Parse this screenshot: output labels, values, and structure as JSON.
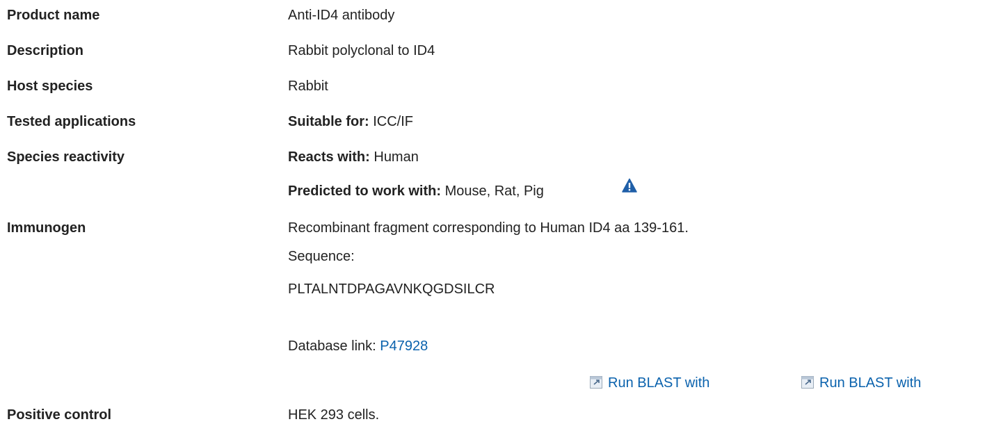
{
  "rows": {
    "product_name": {
      "label": "Product name",
      "value": "Anti-ID4 antibody"
    },
    "description": {
      "label": "Description",
      "value": "Rabbit polyclonal to ID4"
    },
    "host_species": {
      "label": "Host species",
      "value": "Rabbit"
    },
    "tested_applications": {
      "label": "Tested applications",
      "prefix": "Suitable for:",
      "value": " ICC/IF"
    },
    "species_reactivity": {
      "label": "Species reactivity",
      "reacts_prefix": "Reacts with:",
      "reacts_value": " Human",
      "predicted_prefix": "Predicted to work with:",
      "predicted_value": " Mouse, Rat, Pig",
      "warning_icon": "warning-triangle-icon"
    },
    "immunogen": {
      "label": "Immunogen",
      "line1": "Recombinant fragment corresponding to Human ID4 aa 139-161.",
      "line2": "Sequence:",
      "sequence": "PLTALNTDPAGAVNKQGDSILCR",
      "db_prefix": "Database link: ",
      "db_link": "P47928",
      "blast_1": "Run BLAST with",
      "blast_2": "Run BLAST with",
      "blast_icon": "external-window-icon"
    },
    "positive_control": {
      "label": "Positive control",
      "value": "HEK 293 cells."
    }
  },
  "colors": {
    "text": "#222222",
    "link": "#0a62ad",
    "warning_icon": "#1f5fa8"
  }
}
